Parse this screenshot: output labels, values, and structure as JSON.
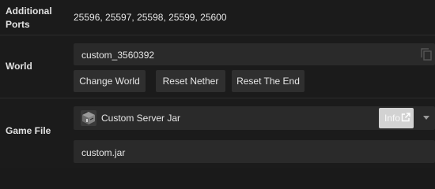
{
  "additional_ports": {
    "label": "Additional Ports",
    "value": "25596, 25597, 25598, 25599, 25600"
  },
  "world": {
    "label": "World",
    "name": "custom_3560392",
    "copy_icon": "copy-icon",
    "buttons": {
      "change": "Change World",
      "reset_nether": "Reset Nether",
      "reset_end": "Reset The End"
    }
  },
  "game_file": {
    "label": "Game File",
    "jar_icon": "server-jar-icon",
    "jar_name": "Custom Server Jar",
    "info_label": "Info",
    "info_icon": "external-link-icon",
    "dropdown_icon": "chevron-down-icon",
    "filename": "custom.jar"
  },
  "colors": {
    "background": "#1b1b1b",
    "field": "#2a2a2a",
    "button": "#2f2f2f",
    "info_button": "#d2d2d2"
  }
}
